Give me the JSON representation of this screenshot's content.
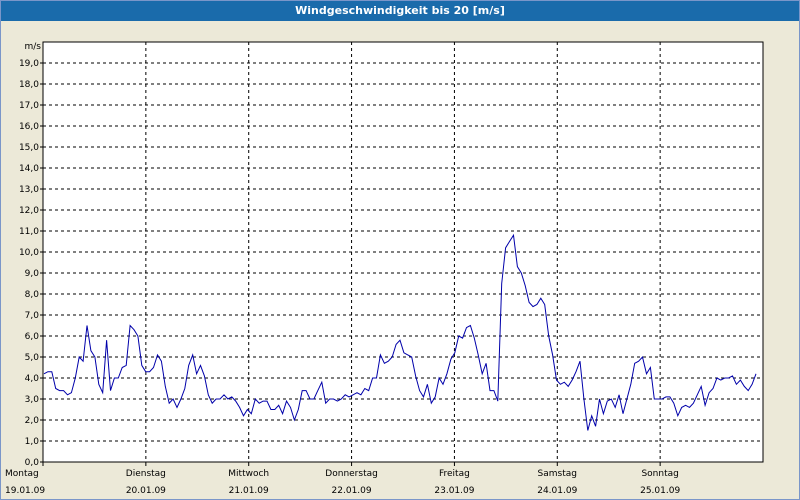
{
  "window": {
    "title": "Windgeschwindigkeit bis 20 [m/s]"
  },
  "chart_data": {
    "type": "line",
    "title": "Windgeschwindigkeit bis 20 [m/s]",
    "ylabel": "m/s",
    "xlabel": "",
    "ylim": [
      0,
      20
    ],
    "xlim": [
      0,
      7
    ],
    "yticks": [
      "0,0",
      "1,0",
      "2,0",
      "3,0",
      "4,0",
      "5,0",
      "6,0",
      "7,0",
      "8,0",
      "9,0",
      "10,0",
      "11,0",
      "12,0",
      "13,0",
      "14,0",
      "15,0",
      "16,0",
      "17,0",
      "18,0",
      "19,0"
    ],
    "day_labels": [
      {
        "day": "Montag",
        "date": "19.01.09"
      },
      {
        "day": "Dienstag",
        "date": "20.01.09"
      },
      {
        "day": "Mittwoch",
        "date": "21.01.09"
      },
      {
        "day": "Donnerstag",
        "date": "22.01.09"
      },
      {
        "day": "Freitag",
        "date": "23.01.09"
      },
      {
        "day": "Samstag",
        "date": "24.01.09"
      },
      {
        "day": "Sonntag",
        "date": "25.01.09"
      }
    ],
    "grid": true,
    "line_color": "#0000aa",
    "series": [
      {
        "values": [
          4.2,
          4.3,
          4.3,
          3.5,
          3.4,
          3.4,
          3.2,
          3.3,
          4.0,
          5.0,
          4.8,
          6.5,
          5.3,
          5.0,
          3.7,
          3.3,
          5.8,
          3.4,
          4.0,
          4.0,
          4.5,
          4.6,
          6.5,
          6.3,
          6.0,
          4.6,
          4.3,
          4.3,
          4.5,
          5.1,
          4.8,
          3.6,
          2.8,
          3.0,
          2.6,
          3.0,
          3.5,
          4.6,
          5.1,
          4.2,
          4.6,
          4.1,
          3.2,
          2.8,
          3.0,
          3.0,
          3.2,
          3.0,
          3.1,
          2.9,
          2.6,
          2.2,
          2.5,
          2.3,
          3.0,
          2.8,
          2.9,
          2.9,
          2.5,
          2.5,
          2.7,
          2.3,
          2.9,
          2.6,
          2.0,
          2.5,
          3.4,
          3.4,
          3.0,
          3.0,
          3.4,
          3.8,
          2.8,
          3.0,
          3.0,
          2.9,
          3.0,
          3.2,
          3.1,
          3.2,
          3.3,
          3.2,
          3.5,
          3.4,
          4.0,
          4.0,
          5.1,
          4.7,
          4.8,
          5.0,
          5.6,
          5.8,
          5.2,
          5.1,
          5.0,
          4.1,
          3.4,
          3.1,
          3.7,
          2.8,
          3.1,
          4.0,
          3.7,
          4.2,
          4.9,
          5.2,
          6.0,
          5.9,
          6.4,
          6.5,
          5.9,
          5.1,
          4.2,
          4.7,
          3.4,
          3.4,
          2.9,
          8.5,
          10.2,
          10.5,
          10.8,
          9.3,
          9.0,
          8.4,
          7.6,
          7.4,
          7.5,
          7.8,
          7.5,
          6.0,
          5.1,
          3.9,
          3.7,
          3.8,
          3.6,
          3.9,
          4.3,
          4.8,
          3.0,
          1.5,
          2.2,
          1.7,
          3.0,
          2.3,
          2.9,
          3.0,
          2.6,
          3.2,
          2.3,
          3.0,
          3.7,
          4.7,
          4.8,
          5.0,
          4.2,
          4.5,
          3.0,
          3.0,
          3.0,
          3.1,
          3.1,
          2.8,
          2.2,
          2.6,
          2.7,
          2.6,
          2.8,
          3.2,
          3.6,
          2.7,
          3.3,
          3.5,
          4.0,
          3.9,
          4.0,
          4.0,
          4.1,
          3.7,
          3.9,
          3.6,
          3.4,
          3.7,
          4.2
        ]
      }
    ]
  }
}
